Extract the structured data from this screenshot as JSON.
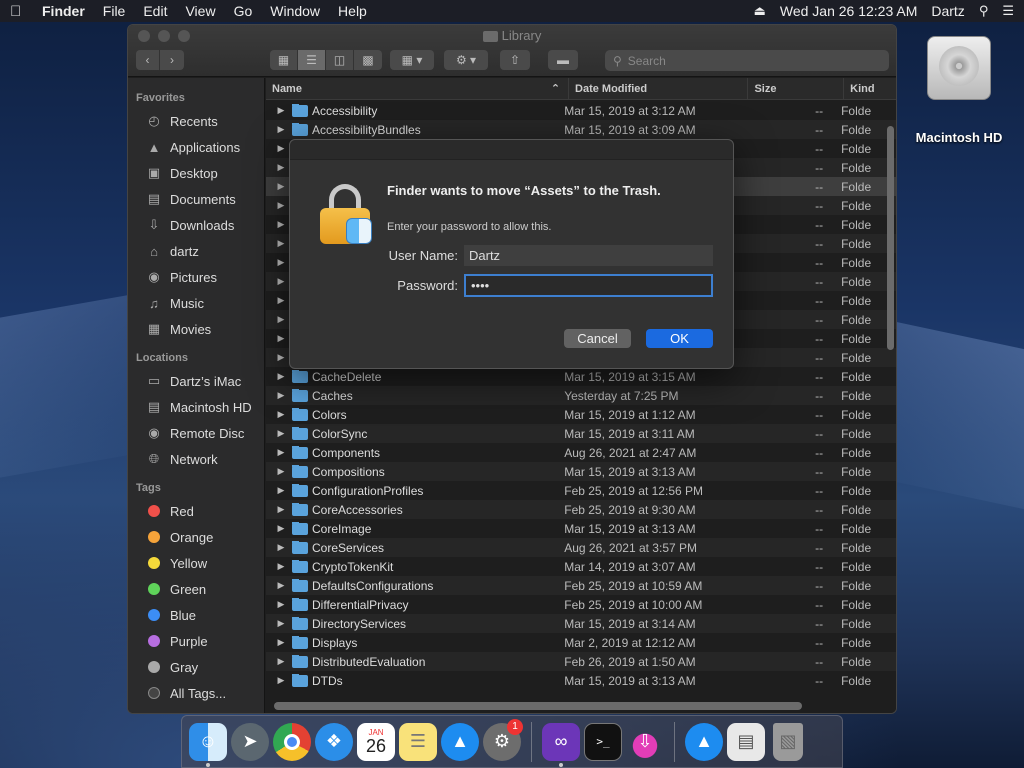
{
  "menubar": {
    "app": "Finder",
    "items": [
      "File",
      "Edit",
      "View",
      "Go",
      "Window",
      "Help"
    ],
    "datetime": "Wed Jan 26  12:23 AM",
    "user": "Dartz"
  },
  "desktop": {
    "drive_label": "Macintosh HD"
  },
  "window": {
    "title": "Library",
    "search_placeholder": "Search"
  },
  "sidebar": {
    "favorites_title": "Favorites",
    "favorites": [
      {
        "label": "Recents",
        "icon": "clock-icon"
      },
      {
        "label": "Applications",
        "icon": "applications-icon"
      },
      {
        "label": "Desktop",
        "icon": "desktop-icon"
      },
      {
        "label": "Documents",
        "icon": "documents-icon"
      },
      {
        "label": "Downloads",
        "icon": "downloads-icon"
      },
      {
        "label": "dartz",
        "icon": "home-icon"
      },
      {
        "label": "Pictures",
        "icon": "pictures-icon"
      },
      {
        "label": "Music",
        "icon": "music-icon"
      },
      {
        "label": "Movies",
        "icon": "movies-icon"
      }
    ],
    "locations_title": "Locations",
    "locations": [
      {
        "label": "Dartz’s iMac",
        "icon": "imac-icon"
      },
      {
        "label": "Macintosh HD",
        "icon": "disk-icon"
      },
      {
        "label": "Remote Disc",
        "icon": "disc-icon"
      },
      {
        "label": "Network",
        "icon": "network-icon"
      }
    ],
    "tags_title": "Tags",
    "tags": [
      {
        "label": "Red",
        "color": "#f0504a"
      },
      {
        "label": "Orange",
        "color": "#f5a33a"
      },
      {
        "label": "Yellow",
        "color": "#f5d93a"
      },
      {
        "label": "Green",
        "color": "#5fd35a"
      },
      {
        "label": "Blue",
        "color": "#3c8df5"
      },
      {
        "label": "Purple",
        "color": "#b76ee0"
      },
      {
        "label": "Gray",
        "color": "#a9a9a9"
      },
      {
        "label": "All Tags...",
        "color": ""
      }
    ]
  },
  "columns": {
    "name": "Name",
    "date": "Date Modified",
    "size": "Size",
    "kind": "Kind"
  },
  "rows": [
    {
      "name": "Accessibility",
      "date": "Mar 15, 2019 at 3:12 AM",
      "size": "--",
      "kind": "Folde"
    },
    {
      "name": "AccessibilityBundles",
      "date": "Mar 15, 2019 at 3:09 AM",
      "size": "--",
      "kind": "Folde"
    },
    {
      "name": "",
      "date": "",
      "size": "--",
      "kind": "Folde"
    },
    {
      "name": "",
      "date": "",
      "size": "--",
      "kind": "Folde"
    },
    {
      "name": "",
      "date": "",
      "size": "--",
      "kind": "Folde"
    },
    {
      "name": "",
      "date": "",
      "size": "--",
      "kind": "Folde"
    },
    {
      "name": "",
      "date": "",
      "size": "--",
      "kind": "Folde"
    },
    {
      "name": "",
      "date": "",
      "size": "--",
      "kind": "Folde"
    },
    {
      "name": "",
      "date": "",
      "size": "--",
      "kind": "Folde"
    },
    {
      "name": "",
      "date": "",
      "size": "--",
      "kind": "Folde"
    },
    {
      "name": "",
      "date": "",
      "size": "--",
      "kind": "Folde"
    },
    {
      "name": "",
      "date": "",
      "size": "--",
      "kind": "Folde"
    },
    {
      "name": "",
      "date": "",
      "size": "--",
      "kind": "Folde"
    },
    {
      "name": "",
      "date": "",
      "size": "--",
      "kind": "Folde"
    },
    {
      "name": "CacheDelete",
      "date": "Mar 15, 2019 at 3:15 AM",
      "size": "--",
      "kind": "Folde"
    },
    {
      "name": "Caches",
      "date": "Yesterday at 7:25 PM",
      "size": "--",
      "kind": "Folde"
    },
    {
      "name": "Colors",
      "date": "Mar 15, 2019 at 1:12 AM",
      "size": "--",
      "kind": "Folde"
    },
    {
      "name": "ColorSync",
      "date": "Mar 15, 2019 at 3:11 AM",
      "size": "--",
      "kind": "Folde"
    },
    {
      "name": "Components",
      "date": "Aug 26, 2021 at 2:47 AM",
      "size": "--",
      "kind": "Folde"
    },
    {
      "name": "Compositions",
      "date": "Mar 15, 2019 at 3:13 AM",
      "size": "--",
      "kind": "Folde"
    },
    {
      "name": "ConfigurationProfiles",
      "date": "Feb 25, 2019 at 12:56 PM",
      "size": "--",
      "kind": "Folde"
    },
    {
      "name": "CoreAccessories",
      "date": "Feb 25, 2019 at 9:30 AM",
      "size": "--",
      "kind": "Folde"
    },
    {
      "name": "CoreImage",
      "date": "Mar 15, 2019 at 3:13 AM",
      "size": "--",
      "kind": "Folde"
    },
    {
      "name": "CoreServices",
      "date": "Aug 26, 2021 at 3:57 PM",
      "size": "--",
      "kind": "Folde"
    },
    {
      "name": "CryptoTokenKit",
      "date": "Mar 14, 2019 at 3:07 AM",
      "size": "--",
      "kind": "Folde"
    },
    {
      "name": "DefaultsConfigurations",
      "date": "Feb 25, 2019 at 10:59 AM",
      "size": "--",
      "kind": "Folde"
    },
    {
      "name": "DifferentialPrivacy",
      "date": "Feb 25, 2019 at 10:00 AM",
      "size": "--",
      "kind": "Folde"
    },
    {
      "name": "DirectoryServices",
      "date": "Mar 15, 2019 at 3:14 AM",
      "size": "--",
      "kind": "Folde"
    },
    {
      "name": "Displays",
      "date": "Mar 2, 2019 at 12:12 AM",
      "size": "--",
      "kind": "Folde"
    },
    {
      "name": "DistributedEvaluation",
      "date": "Feb 26, 2019 at 1:50 AM",
      "size": "--",
      "kind": "Folde"
    },
    {
      "name": "DTDs",
      "date": "Mar 15, 2019 at 3:13 AM",
      "size": "--",
      "kind": "Folde"
    }
  ],
  "dialog": {
    "title": "Finder wants to move “Assets” to the Trash.",
    "subtitle": "Enter your password to allow this.",
    "username_label": "User Name:",
    "username_value": "Dartz",
    "password_label": "Password:",
    "password_value": "••••",
    "cancel_label": "Cancel",
    "ok_label": "OK"
  },
  "dock": {
    "calendar_month": "JAN",
    "calendar_day": "26",
    "system_prefs_badge": "1"
  },
  "colors": {
    "accent": "#1b6ae0",
    "folder": "#5aa3dc"
  }
}
